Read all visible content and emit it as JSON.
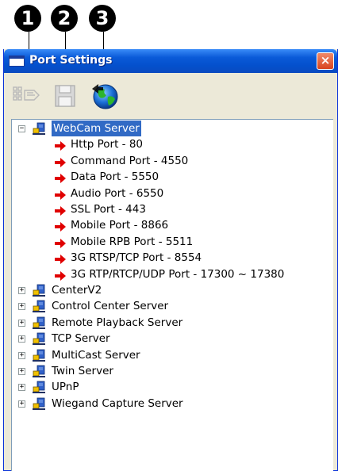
{
  "callouts": [
    "1",
    "2",
    "3"
  ],
  "window": {
    "title": "Port Settings",
    "close_glyph": "×"
  },
  "toolbar": {
    "buttons": [
      {
        "icon": "port-config-icon",
        "enabled": false
      },
      {
        "icon": "save-icon",
        "enabled": false
      },
      {
        "icon": "globe-icon",
        "enabled": true
      }
    ]
  },
  "tree": {
    "root": {
      "label": "WebCam Server",
      "expanded": true,
      "selected": true,
      "children": [
        "Http Port - 80",
        "Command Port - 4550",
        "Data Port - 5550",
        "Audio Port - 6550",
        "SSL Port - 443",
        "Mobile Port - 8866",
        "Mobile RPB Port - 5511",
        "3G RTSP/TCP Port - 8554",
        "3G RTP/RTCP/UDP Port - 17300 ~ 17380"
      ]
    },
    "collapsed_nodes": [
      "CenterV2",
      "Control Center Server",
      "Remote Playback Server",
      "TCP Server",
      "MultiCast Server",
      "Twin Server",
      "UPnP",
      "Wiegand Capture Server"
    ],
    "expand_glyph": "+",
    "collapse_glyph": "−"
  },
  "colors": {
    "arrow": "#e00000",
    "selection": "#316ac5",
    "titlebar": "#0a5ad8"
  }
}
